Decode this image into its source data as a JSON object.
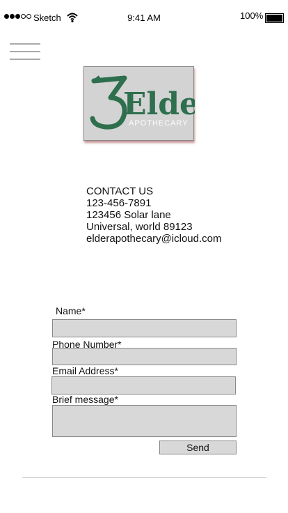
{
  "status_bar": {
    "carrier": "Sketch",
    "time": "9:41 AM",
    "battery_percent": "100%",
    "signal_bars_filled": 3,
    "signal_bars_total": 5,
    "battery_level": 1.0
  },
  "header": {
    "menu_icon": "hamburger-menu-icon"
  },
  "logo": {
    "brand_name": "Elder",
    "tagline": "APOTHECARY",
    "brand_color": "#2e6f4e"
  },
  "contact": {
    "heading": "CONTACT US",
    "phone": "123-456-7891",
    "address_line1": "123456 Solar lane",
    "address_line2": "Universal, world 89123",
    "email": "elderapothecary@icloud.com"
  },
  "form": {
    "name_label": "Name*",
    "phone_label": "Phone Number*",
    "email_label": "Email Address*",
    "message_label": "Brief message*",
    "name_value": "",
    "phone_value": "",
    "email_value": "",
    "message_value": "",
    "send_label": "Send"
  }
}
